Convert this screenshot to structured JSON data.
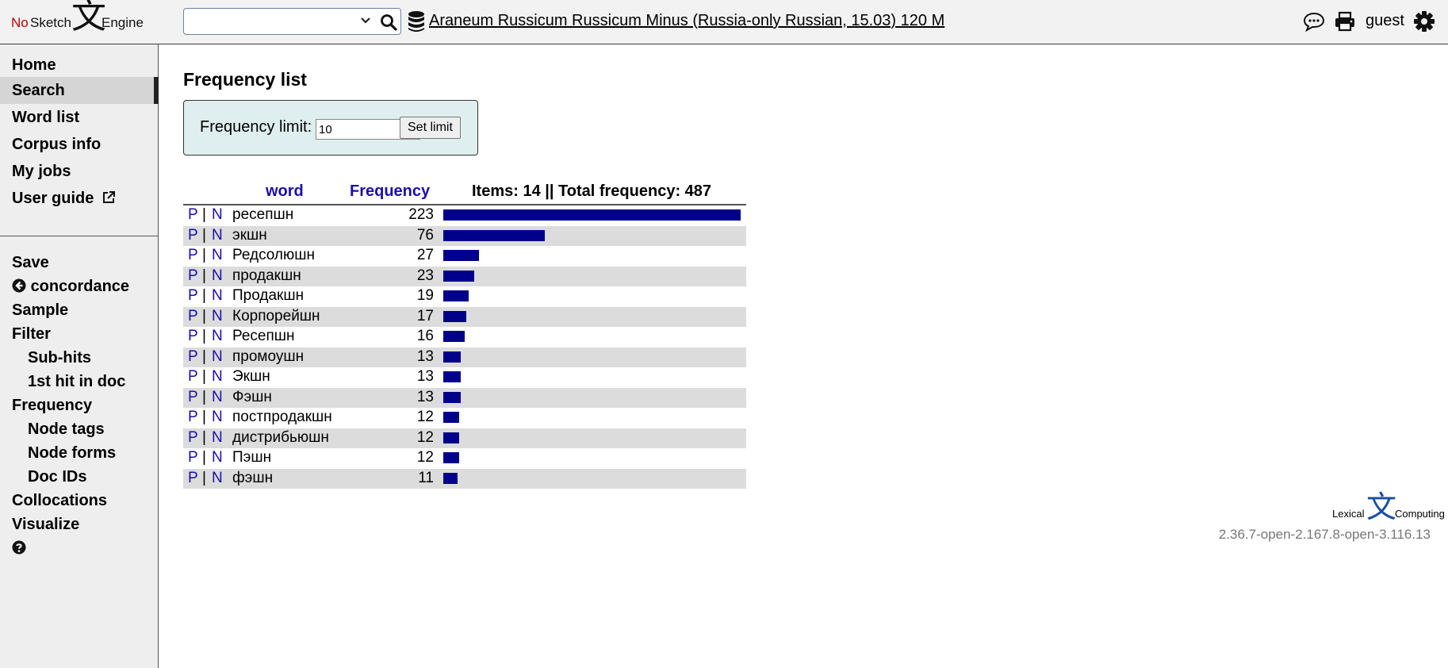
{
  "header": {
    "logo": {
      "no": "No",
      "sketch": "Sketch",
      "glyph": "文",
      "engine": "Engine"
    },
    "search": {
      "value": "",
      "placeholder": ""
    },
    "corpus_name": "Araneum Russicum Russicum Minus (Russia-only Russian, 15.03) 120 M",
    "user": "guest",
    "icons": [
      "search-icon",
      "database-icon",
      "feedback-icon",
      "print-icon",
      "settings-icon"
    ]
  },
  "sidebar": {
    "primary": [
      {
        "label": "Home"
      },
      {
        "label": "Search"
      },
      {
        "label": "Word list"
      },
      {
        "label": "Corpus info"
      },
      {
        "label": "My jobs"
      },
      {
        "label": "User guide"
      }
    ],
    "secondary": [
      {
        "label": "Save"
      },
      {
        "label": "concordance"
      },
      {
        "label": "Sample"
      },
      {
        "label": "Filter"
      },
      {
        "label": "Sub-hits"
      },
      {
        "label": "1st hit in doc"
      },
      {
        "label": "Frequency"
      },
      {
        "label": "Node tags"
      },
      {
        "label": "Node forms"
      },
      {
        "label": "Doc IDs"
      },
      {
        "label": "Collocations"
      },
      {
        "label": "Visualize"
      }
    ]
  },
  "main": {
    "title": "Frequency list",
    "limit": {
      "label": "Frequency limit:",
      "value": "10",
      "button": "Set limit"
    },
    "table": {
      "col_word": "word",
      "col_freq": "Frequency",
      "summary": "Items: 14 || Total frequency: 487",
      "link_p": "P",
      "link_n": "N",
      "sep": "|",
      "rows": [
        {
          "word": "ресепшн",
          "freq": 223
        },
        {
          "word": "экшн",
          "freq": 76
        },
        {
          "word": "Редсолюшн",
          "freq": 27
        },
        {
          "word": "продакшн",
          "freq": 23
        },
        {
          "word": "Продакшн",
          "freq": 19
        },
        {
          "word": "Корпорейшн",
          "freq": 17
        },
        {
          "word": "Ресепшн",
          "freq": 16
        },
        {
          "word": "промоушн",
          "freq": 13
        },
        {
          "word": "Экшн",
          "freq": 13
        },
        {
          "word": "Фэшн",
          "freq": 13
        },
        {
          "word": "постпродакшн",
          "freq": 12
        },
        {
          "word": "дистрибьюшн",
          "freq": 12
        },
        {
          "word": "Пэшн",
          "freq": 12
        },
        {
          "word": "фэшн",
          "freq": 11
        }
      ],
      "bar_color": "#00008b"
    }
  },
  "footer": {
    "brand_left": "Lexical",
    "brand_glyph": "文",
    "brand_right": "Computing",
    "version": "2.36.7-open-2.167.8-open-3.116.13"
  }
}
